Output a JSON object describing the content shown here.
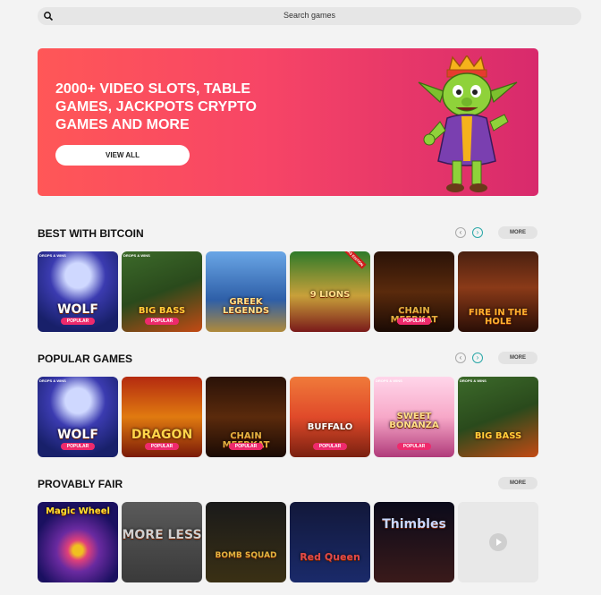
{
  "search": {
    "placeholder": "Search games"
  },
  "hero": {
    "title": "2000+ VIDEO SLOTS, TABLE GAMES, JACKPOTS CRYPTO GAMES AND MORE",
    "button": "VIEW ALL"
  },
  "sections": [
    {
      "title": "BEST WITH BITCOIN",
      "more": "MORE",
      "games": [
        {
          "name": "WOLF",
          "badge": "POPULAR",
          "tag": "DROPS & WINS"
        },
        {
          "name": "BIG BASS",
          "badge": "POPULAR",
          "tag": "DROPS & WINS"
        },
        {
          "name": "GREEK LEGENDS",
          "badge": "",
          "tag": ""
        },
        {
          "name": "9 LIONS",
          "badge": "",
          "tag": "XMAS EDITION"
        },
        {
          "name": "CHAIN MEERKAT",
          "badge": "POPULAR",
          "tag": ""
        },
        {
          "name": "FIRE IN THE HOLE",
          "badge": "",
          "tag": ""
        }
      ]
    },
    {
      "title": "POPULAR GAMES",
      "more": "MORE",
      "games": [
        {
          "name": "WOLF",
          "badge": "POPULAR",
          "tag": "DROPS & WINS"
        },
        {
          "name": "DRAGON",
          "badge": "POPULAR",
          "tag": ""
        },
        {
          "name": "CHAIN MEERKAT",
          "badge": "POPULAR",
          "tag": ""
        },
        {
          "name": "BUFFALO",
          "badge": "POPULAR",
          "tag": ""
        },
        {
          "name": "SWEET BONANZA",
          "badge": "POPULAR",
          "tag": "DROPS & WINS"
        },
        {
          "name": "BIG BASS",
          "badge": "",
          "tag": "DROPS & WINS"
        }
      ]
    },
    {
      "title": "PROVABLY FAIR",
      "more": "MORE",
      "games": [
        {
          "name": "Magic Wheel",
          "badge": "",
          "tag": ""
        },
        {
          "name": "MORE LESS",
          "badge": "",
          "tag": ""
        },
        {
          "name": "BOMB SQUAD",
          "badge": "",
          "tag": ""
        },
        {
          "name": "Red Queen",
          "badge": "",
          "tag": ""
        },
        {
          "name": "Thimbles",
          "badge": "",
          "tag": ""
        },
        {
          "name": "",
          "badge": "",
          "tag": ""
        }
      ]
    }
  ],
  "colors": {
    "hero_start": "#ff5757",
    "hero_end": "#d82a6c",
    "badge": "#ee2a6c",
    "nav_active": "#2aa7a7"
  }
}
